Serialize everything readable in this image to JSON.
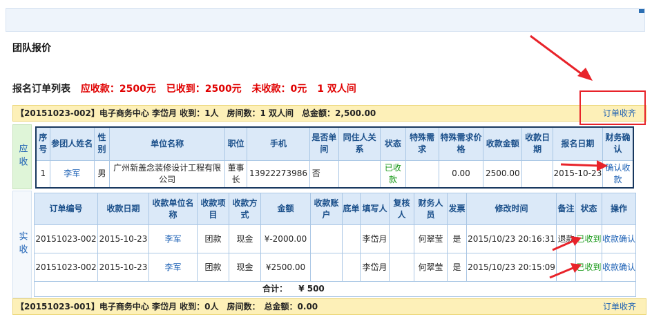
{
  "page_title": "团队报价",
  "summary": {
    "label": "报名订单列表",
    "receivable": "应收款：2500元",
    "received": "已收到：2500元",
    "unreceived": "未收款：0元",
    "rooms": "1 双人间"
  },
  "orders": [
    {
      "header": "【20151023-002】电子商务中心 李岱月 收到：1人　房间数：1 双人间　总金额：2,500.00",
      "link": "订单收齐"
    },
    {
      "header": "【20151023-001】电子商务中心 李岱月 收到：0人　房间数：　总金额：0.00",
      "link": "订单收齐"
    }
  ],
  "side_labels": {
    "receivable": "应收",
    "actual": "实收"
  },
  "participant_table": {
    "headers": [
      "序号",
      "参团人姓名",
      "性别",
      "单位名称",
      "职位",
      "手机",
      "是否单间",
      "同住人关系",
      "状态",
      "特殊需求",
      "特殊需求价格",
      "收款金额",
      "收款日期",
      "报名日期",
      "财务确认"
    ],
    "rows": [
      [
        "1",
        "李军",
        "男",
        "广州新盖念装修设计工程有限公司",
        "董事长",
        "13922273986",
        "否",
        "",
        "已收款",
        "",
        "0.00",
        "2500.00",
        "",
        "2015-10-23",
        "确认收款"
      ]
    ]
  },
  "payment_table": {
    "headers": [
      "订单编号",
      "收款日期",
      "收款单位名称",
      "收款项目",
      "收款方式",
      "金额",
      "收款账户",
      "底单",
      "填写人",
      "复核人",
      "财务人员",
      "发票",
      "修改时间",
      "备注",
      "状态",
      "操作"
    ],
    "rows": [
      [
        "20151023-002",
        "2015-10-23",
        "李军",
        "团款",
        "现金",
        "¥-2000.00",
        "",
        "",
        "李岱月",
        "",
        "何翠莹",
        "是",
        "2015/10/23 20:16:31",
        "退款",
        "已收到",
        "收款确认"
      ],
      [
        "20151023-002",
        "2015-10-23",
        "李军",
        "团款",
        "现金",
        "¥2500.00",
        "",
        "",
        "李岱月",
        "",
        "何翠莹",
        "是",
        "2015/10/23 20:15:09",
        "",
        "已收到",
        "收款确认"
      ]
    ],
    "total_label": "合计：",
    "total_value": "¥ 500"
  },
  "colors": {
    "accent": "#e8232a",
    "link": "#1a5fb4",
    "status_green": "#1a9a1a",
    "order_bar": "#fdf0b8"
  }
}
